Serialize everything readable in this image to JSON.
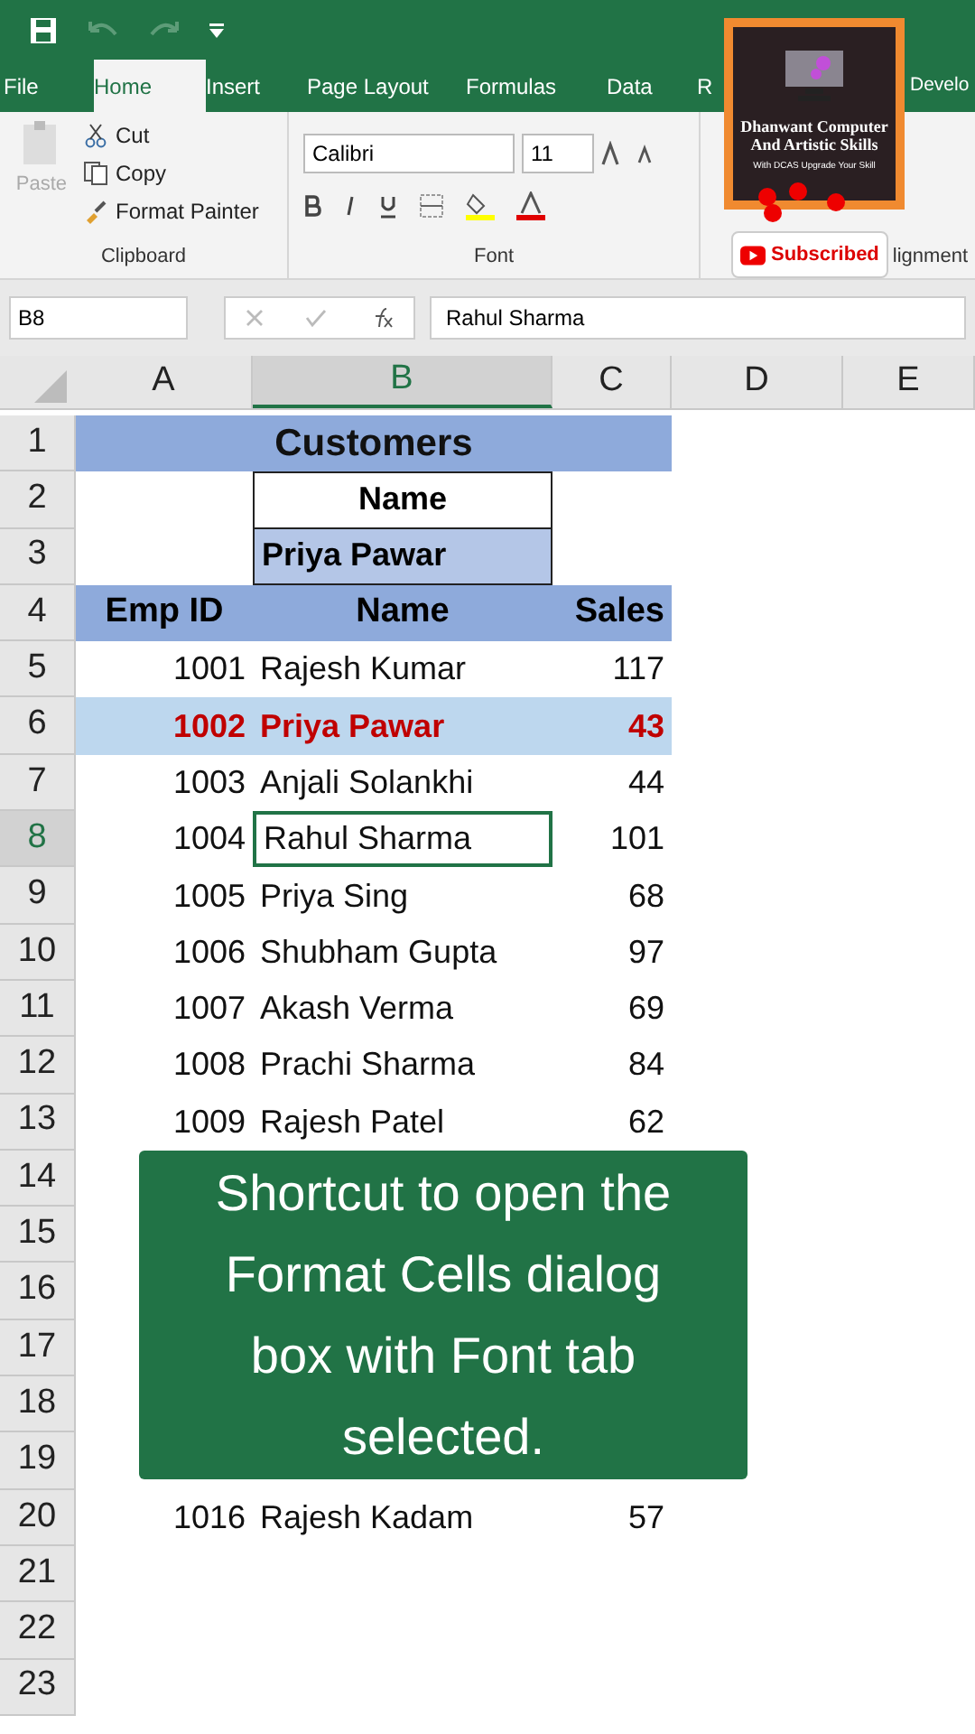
{
  "tabs": [
    {
      "label": "File",
      "selected": false
    },
    {
      "label": "Home",
      "selected": true
    },
    {
      "label": "Insert",
      "selected": false
    },
    {
      "label": "Page Layout",
      "selected": false
    },
    {
      "label": "Formulas",
      "selected": false
    },
    {
      "label": "Data",
      "selected": false
    },
    {
      "label": "R",
      "selected": false
    },
    {
      "label": "Develo",
      "selected": false
    }
  ],
  "ribbon": {
    "paste": "Paste",
    "cut": "Cut",
    "copy": "Copy",
    "format_painter": "Format Painter",
    "clipboard_label": "Clipboard",
    "font_name": "Calibri",
    "font_size": "11",
    "font_label": "Font",
    "alignment_label": "lignment"
  },
  "channel_overlay": {
    "title": "Dhanwant Computer And Artistic Skills",
    "tagline": "With DCAS Upgrade Your Skill",
    "subscribe": "Subscribed"
  },
  "name_box": "B8",
  "formula": "Rahul Sharma",
  "columns": [
    {
      "label": "A",
      "selected": false
    },
    {
      "label": "B",
      "selected": true
    },
    {
      "label": "C",
      "selected": false
    },
    {
      "label": "D",
      "selected": false
    },
    {
      "label": "E",
      "selected": false
    }
  ],
  "rows": [
    {
      "n": "1",
      "selected": false,
      "kind": "title",
      "text": "Customers"
    },
    {
      "n": "2",
      "selected": false,
      "kind": "lookup_label",
      "text": "Name"
    },
    {
      "n": "3",
      "selected": false,
      "kind": "lookup_value",
      "text": "Priya Pawar"
    },
    {
      "n": "4",
      "selected": false,
      "kind": "header",
      "cells": [
        "Emp ID",
        "Name",
        "Sales"
      ]
    },
    {
      "n": "5",
      "selected": false,
      "kind": "data",
      "highlighted": false,
      "active": false,
      "cells": [
        "1001",
        "Rajesh Kumar",
        "117"
      ]
    },
    {
      "n": "6",
      "selected": false,
      "kind": "data",
      "highlighted": true,
      "active": false,
      "cells": [
        "1002",
        "Priya Pawar",
        "43"
      ]
    },
    {
      "n": "7",
      "selected": false,
      "kind": "data",
      "highlighted": false,
      "active": false,
      "cells": [
        "1003",
        "Anjali Solankhi",
        "44"
      ]
    },
    {
      "n": "8",
      "selected": true,
      "kind": "data",
      "highlighted": false,
      "active": true,
      "cells": [
        "1004",
        "Rahul Sharma",
        "101"
      ]
    },
    {
      "n": "9",
      "selected": false,
      "kind": "data",
      "highlighted": false,
      "active": false,
      "cells": [
        "1005",
        "Priya Sing",
        "68"
      ]
    },
    {
      "n": "10",
      "selected": false,
      "kind": "data",
      "highlighted": false,
      "active": false,
      "cells": [
        "1006",
        "Shubham Gupta",
        "97"
      ]
    },
    {
      "n": "11",
      "selected": false,
      "kind": "data",
      "highlighted": false,
      "active": false,
      "cells": [
        "1007",
        "Akash Verma",
        "69"
      ]
    },
    {
      "n": "12",
      "selected": false,
      "kind": "data",
      "highlighted": false,
      "active": false,
      "cells": [
        "1008",
        "Prachi Sharma",
        "84"
      ]
    },
    {
      "n": "13",
      "selected": false,
      "kind": "data",
      "highlighted": false,
      "active": false,
      "cells": [
        "1009",
        "Rajesh Patel",
        "62"
      ]
    },
    {
      "n": "14",
      "selected": false,
      "kind": "empty"
    },
    {
      "n": "15",
      "selected": false,
      "kind": "empty"
    },
    {
      "n": "16",
      "selected": false,
      "kind": "empty"
    },
    {
      "n": "17",
      "selected": false,
      "kind": "empty"
    },
    {
      "n": "18",
      "selected": false,
      "kind": "empty"
    },
    {
      "n": "19",
      "selected": false,
      "kind": "empty"
    },
    {
      "n": "20",
      "selected": false,
      "kind": "data",
      "highlighted": false,
      "active": false,
      "cells": [
        "1016",
        "Rajesh Kadam",
        "57"
      ]
    },
    {
      "n": "21",
      "selected": false,
      "kind": "empty"
    },
    {
      "n": "22",
      "selected": false,
      "kind": "empty"
    },
    {
      "n": "23",
      "selected": false,
      "kind": "empty"
    }
  ],
  "caption": "Shortcut to open the Format Cells dialog box with Font tab selected."
}
